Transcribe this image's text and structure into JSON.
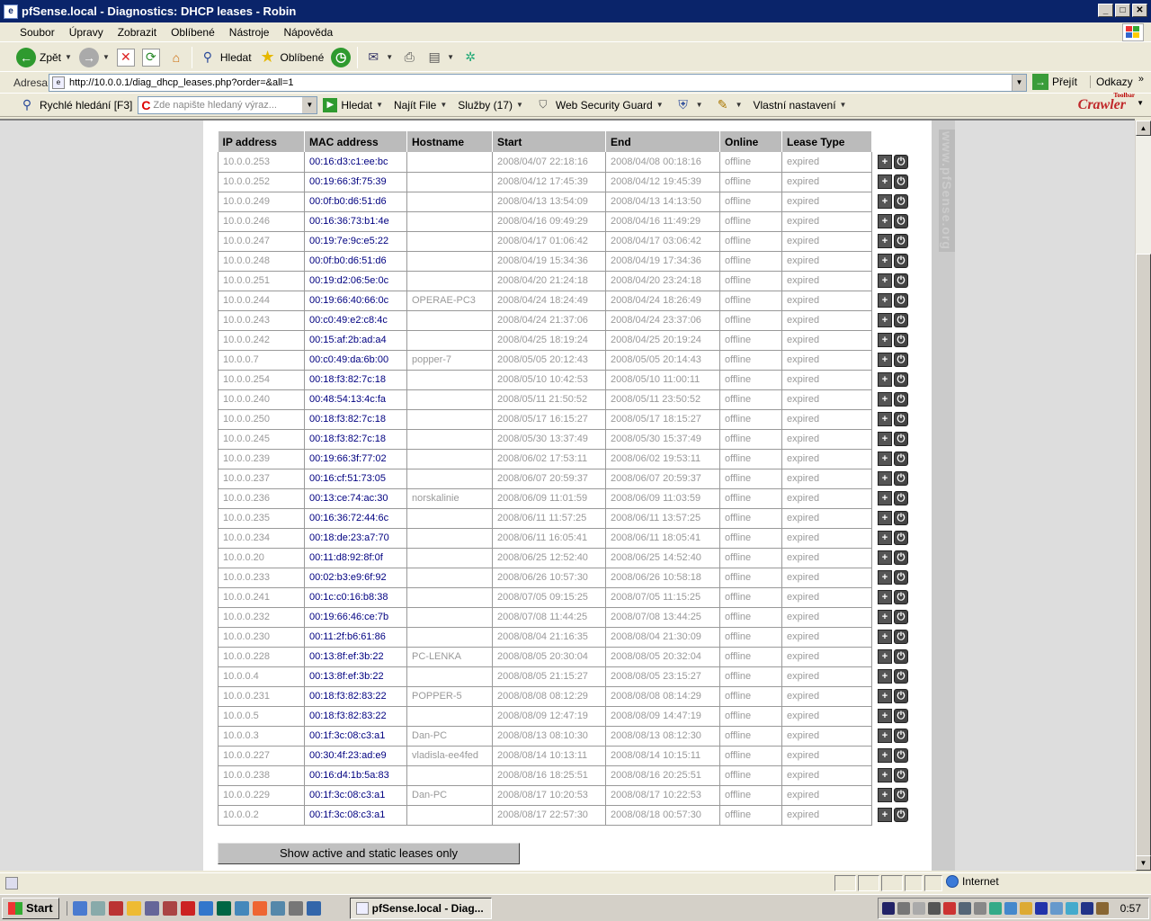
{
  "window": {
    "title": "pfSense.local - Diagnostics: DHCP leases - Robin"
  },
  "menu": [
    "Soubor",
    "Úpravy",
    "Zobrazit",
    "Oblíbené",
    "Nástroje",
    "Nápověda"
  ],
  "toolbar": {
    "back": "Zpět",
    "search": "Hledat",
    "favorites": "Oblíbené"
  },
  "address": {
    "label": "Adresa",
    "url": "http://10.0.0.1/diag_dhcp_leases.php?order=&all=1",
    "go": "Přejít",
    "links": "Odkazy"
  },
  "crawler": {
    "quick_search": "Rychlé hledání [F3]",
    "search_placeholder": "Zde napište hledaný výraz...",
    "search_button": "Hledat",
    "find_file": "Najít File",
    "services": "Služby (17)",
    "web_guard": "Web Security Guard",
    "custom": "Vlastní nastavení",
    "logo": "Crawler",
    "logo_small": "Toolbar"
  },
  "watermark": "www.pfSense.org",
  "table": {
    "headers": [
      "IP address",
      "MAC address",
      "Hostname",
      "Start",
      "End",
      "Online",
      "Lease Type"
    ],
    "rows": [
      [
        "10.0.0.253",
        "00:16:d3:c1:ee:bc",
        "",
        "2008/04/07 22:18:16",
        "2008/04/08 00:18:16",
        "offline",
        "expired"
      ],
      [
        "10.0.0.252",
        "00:19:66:3f:75:39",
        "",
        "2008/04/12 17:45:39",
        "2008/04/12 19:45:39",
        "offline",
        "expired"
      ],
      [
        "10.0.0.249",
        "00:0f:b0:d6:51:d6",
        "",
        "2008/04/13 13:54:09",
        "2008/04/13 14:13:50",
        "offline",
        "expired"
      ],
      [
        "10.0.0.246",
        "00:16:36:73:b1:4e",
        "",
        "2008/04/16 09:49:29",
        "2008/04/16 11:49:29",
        "offline",
        "expired"
      ],
      [
        "10.0.0.247",
        "00:19:7e:9c:e5:22",
        "",
        "2008/04/17 01:06:42",
        "2008/04/17 03:06:42",
        "offline",
        "expired"
      ],
      [
        "10.0.0.248",
        "00:0f:b0:d6:51:d6",
        "",
        "2008/04/19 15:34:36",
        "2008/04/19 17:34:36",
        "offline",
        "expired"
      ],
      [
        "10.0.0.251",
        "00:19:d2:06:5e:0c",
        "",
        "2008/04/20 21:24:18",
        "2008/04/20 23:24:18",
        "offline",
        "expired"
      ],
      [
        "10.0.0.244",
        "00:19:66:40:66:0c",
        "OPERAE-PC3",
        "2008/04/24 18:24:49",
        "2008/04/24 18:26:49",
        "offline",
        "expired"
      ],
      [
        "10.0.0.243",
        "00:c0:49:e2:c8:4c",
        "",
        "2008/04/24 21:37:06",
        "2008/04/24 23:37:06",
        "offline",
        "expired"
      ],
      [
        "10.0.0.242",
        "00:15:af:2b:ad:a4",
        "",
        "2008/04/25 18:19:24",
        "2008/04/25 20:19:24",
        "offline",
        "expired"
      ],
      [
        "10.0.0.7",
        "00:c0:49:da:6b:00",
        "popper-7",
        "2008/05/05 20:12:43",
        "2008/05/05 20:14:43",
        "offline",
        "expired"
      ],
      [
        "10.0.0.254",
        "00:18:f3:82:7c:18",
        "",
        "2008/05/10 10:42:53",
        "2008/05/10 11:00:11",
        "offline",
        "expired"
      ],
      [
        "10.0.0.240",
        "00:48:54:13:4c:fa",
        "",
        "2008/05/11 21:50:52",
        "2008/05/11 23:50:52",
        "offline",
        "expired"
      ],
      [
        "10.0.0.250",
        "00:18:f3:82:7c:18",
        "",
        "2008/05/17 16:15:27",
        "2008/05/17 18:15:27",
        "offline",
        "expired"
      ],
      [
        "10.0.0.245",
        "00:18:f3:82:7c:18",
        "",
        "2008/05/30 13:37:49",
        "2008/05/30 15:37:49",
        "offline",
        "expired"
      ],
      [
        "10.0.0.239",
        "00:19:66:3f:77:02",
        "",
        "2008/06/02 17:53:11",
        "2008/06/02 19:53:11",
        "offline",
        "expired"
      ],
      [
        "10.0.0.237",
        "00:16:cf:51:73:05",
        "",
        "2008/06/07 20:59:37",
        "2008/06/07 20:59:37",
        "offline",
        "expired"
      ],
      [
        "10.0.0.236",
        "00:13:ce:74:ac:30",
        "norskalinie",
        "2008/06/09 11:01:59",
        "2008/06/09 11:03:59",
        "offline",
        "expired"
      ],
      [
        "10.0.0.235",
        "00:16:36:72:44:6c",
        "",
        "2008/06/11 11:57:25",
        "2008/06/11 13:57:25",
        "offline",
        "expired"
      ],
      [
        "10.0.0.234",
        "00:18:de:23:a7:70",
        "",
        "2008/06/11 16:05:41",
        "2008/06/11 18:05:41",
        "offline",
        "expired"
      ],
      [
        "10.0.0.20",
        "00:11:d8:92:8f:0f",
        "",
        "2008/06/25 12:52:40",
        "2008/06/25 14:52:40",
        "offline",
        "expired"
      ],
      [
        "10.0.0.233",
        "00:02:b3:e9:6f:92",
        "",
        "2008/06/26 10:57:30",
        "2008/06/26 10:58:18",
        "offline",
        "expired"
      ],
      [
        "10.0.0.241",
        "00:1c:c0:16:b8:38",
        "",
        "2008/07/05 09:15:25",
        "2008/07/05 11:15:25",
        "offline",
        "expired"
      ],
      [
        "10.0.0.232",
        "00:19:66:46:ce:7b",
        "",
        "2008/07/08 11:44:25",
        "2008/07/08 13:44:25",
        "offline",
        "expired"
      ],
      [
        "10.0.0.230",
        "00:11:2f:b6:61:86",
        "",
        "2008/08/04 21:16:35",
        "2008/08/04 21:30:09",
        "offline",
        "expired"
      ],
      [
        "10.0.0.228",
        "00:13:8f:ef:3b:22",
        "PC-LENKA",
        "2008/08/05 20:30:04",
        "2008/08/05 20:32:04",
        "offline",
        "expired"
      ],
      [
        "10.0.0.4",
        "00:13:8f:ef:3b:22",
        "",
        "2008/08/05 21:15:27",
        "2008/08/05 23:15:27",
        "offline",
        "expired"
      ],
      [
        "10.0.0.231",
        "00:18:f3:82:83:22",
        "POPPER-5",
        "2008/08/08 08:12:29",
        "2008/08/08 08:14:29",
        "offline",
        "expired"
      ],
      [
        "10.0.0.5",
        "00:18:f3:82:83:22",
        "",
        "2008/08/09 12:47:19",
        "2008/08/09 14:47:19",
        "offline",
        "expired"
      ],
      [
        "10.0.0.3",
        "00:1f:3c:08:c3:a1",
        "Dan-PC",
        "2008/08/13 08:10:30",
        "2008/08/13 08:12:30",
        "offline",
        "expired"
      ],
      [
        "10.0.0.227",
        "00:30:4f:23:ad:e9",
        "vladisla-ee4fed",
        "2008/08/14 10:13:11",
        "2008/08/14 10:15:11",
        "offline",
        "expired"
      ],
      [
        "10.0.0.238",
        "00:16:d4:1b:5a:83",
        "",
        "2008/08/16 18:25:51",
        "2008/08/16 20:25:51",
        "offline",
        "expired"
      ],
      [
        "10.0.0.229",
        "00:1f:3c:08:c3:a1",
        "Dan-PC",
        "2008/08/17 10:20:53",
        "2008/08/17 10:22:53",
        "offline",
        "expired"
      ],
      [
        "10.0.0.2",
        "00:1f:3c:08:c3:a1",
        "",
        "2008/08/17 22:57:30",
        "2008/08/18 00:57:30",
        "offline",
        "expired"
      ]
    ]
  },
  "show_button": "Show active and static leases only",
  "status": {
    "zone": "Internet"
  },
  "taskbar": {
    "start": "Start",
    "task": "pfSense.local - Diag...",
    "clock": "0:57"
  }
}
